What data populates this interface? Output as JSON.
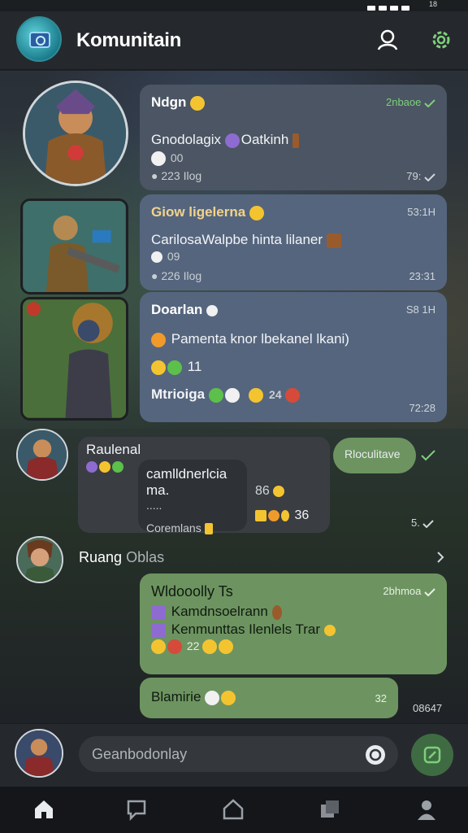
{
  "app": {
    "title": "Komunitain"
  },
  "status": {
    "battery": "18"
  },
  "messages": [
    {
      "name": "Ndgn",
      "time": "2nbaoe",
      "lines": [
        "Gnodolagix",
        "Oatkinh"
      ],
      "sub": "00",
      "meta": "223 Ilog",
      "meta_time": "79:"
    },
    {
      "name": "Giow ligelerna",
      "time": "53:1H",
      "lines": [
        "CarilosaWalpbe hinta lilaner"
      ],
      "sub": "09",
      "meta": "226 Ilog",
      "meta_time": "23:31"
    },
    {
      "name": "Doarlan",
      "time": "S8 1H",
      "lines": [
        "Pamenta knor lbekanel lkani)"
      ],
      "reactions": "11",
      "footer": "Mtrioiga",
      "footer_count": "24",
      "footer_time": "72:28"
    }
  ],
  "group": {
    "name": "Raulenal",
    "text": "camlldnerlcia ma.",
    "dots": ".....",
    "quote": "Coremlans",
    "reply_label": "Rloculitave",
    "count_a": "86",
    "count_b": "36",
    "time": "5."
  },
  "thread": {
    "name": "Ruang",
    "name_suffix": "Oblas"
  },
  "green_card": {
    "title": "Wldooolly Ts",
    "time": "2bhmoa",
    "line1": "Kamdnsoelrann",
    "line2": "Kenmunttas Ilenlels Trar",
    "count": "22"
  },
  "green_small": {
    "text": "Blamirie",
    "time": "08647",
    "time2": "32"
  },
  "composer": {
    "placeholder": "Geanbodonlay"
  },
  "nav": [
    "home-icon",
    "chat-icon",
    "house-icon",
    "cards-icon",
    "profile-icon"
  ],
  "colors": {
    "accent_green": "#6d9460",
    "bubble_blue": "#55657e",
    "bubble_slate": "#4b5563"
  }
}
